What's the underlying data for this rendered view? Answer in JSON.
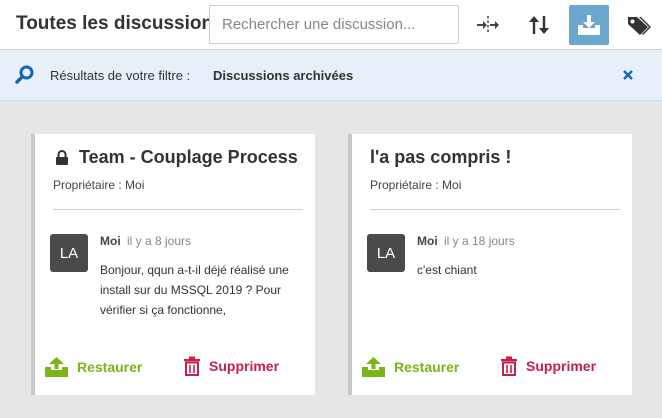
{
  "header": {
    "title": "Toutes les discussion",
    "search_placeholder": "Rechercher une discussion..."
  },
  "filter": {
    "label": "Résultats de votre filtre :",
    "value": "Discussions archivées"
  },
  "colors": {
    "accent": "#6ba6cc",
    "restore": "#7cb518",
    "delete": "#c81e4a"
  },
  "cards": [
    {
      "title": "Team - Couplage Process",
      "locked": true,
      "owner": "Propriétaire : Moi",
      "avatar": "LA",
      "author": "Moi",
      "time": "il y a 8 jours",
      "message": "Bonjour, qqun a-t-il déjé réalisé une install sur du MSSQL 2019 ? Pour vérifier si ça fonctionne,",
      "restore_label": "Restaurer",
      "delete_label": "Supprimer"
    },
    {
      "title": "l'a pas compris !",
      "locked": false,
      "owner": "Propriétaire : Moi",
      "avatar": "LA",
      "author": "Moi",
      "time": "il y a 18 jours",
      "message": "c'est chiant",
      "restore_label": "Restaurer",
      "delete_label": "Supprimer"
    }
  ]
}
